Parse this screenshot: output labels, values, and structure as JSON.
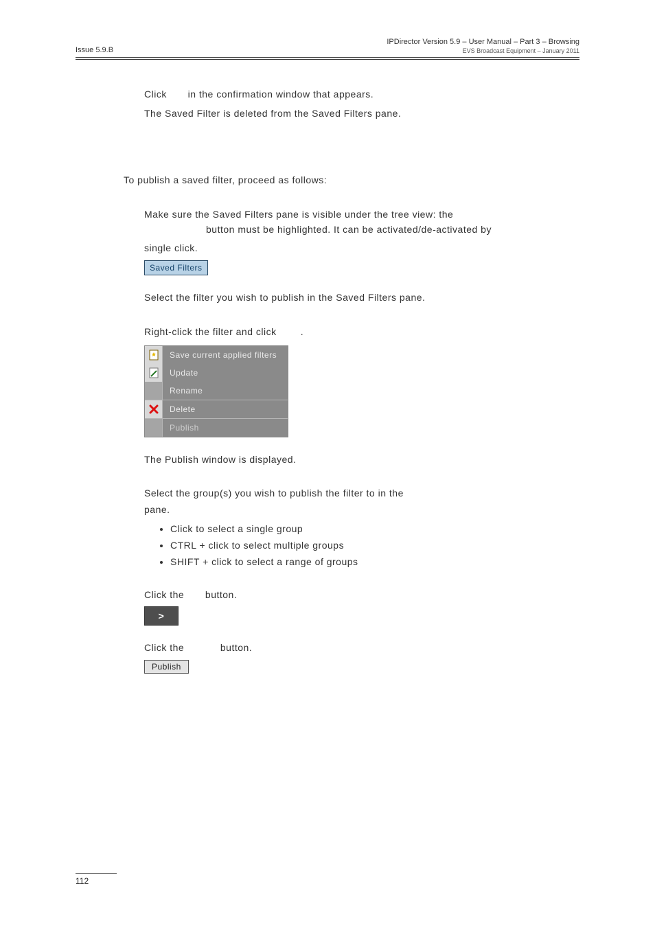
{
  "header": {
    "left": "Issue 5.9.B",
    "right_main": "IPDirector Version 5.9 – User Manual – Part 3 – Browsing",
    "right_sub": "EVS Broadcast Equipment – January 2011"
  },
  "intro": {
    "click_prefix": "Click ",
    "click_suffix": " in the confirmation window that appears.",
    "deleted": "The Saved Filter is deleted from the Saved Filters pane."
  },
  "publish_intro": "To publish a saved filter, proceed as follows:",
  "step1": {
    "line1": "Make sure the Saved Filters pane is visible under the tree view: the",
    "line2_pre": "",
    "line2_post": " button must be highlighted. It can be activated/de-activated by",
    "line3": "single click.",
    "btn": "Saved Filters"
  },
  "step2": "Select the filter you wish to publish in the Saved Filters pane.",
  "step3_pre": "Right-click the filter and click ",
  "step3_post": ".",
  "ctx": {
    "save": "Save current applied filters",
    "update": "Update",
    "rename": "Rename",
    "delete": "Delete",
    "publish": "Publish"
  },
  "step3_result": "The Publish window is displayed.",
  "step4_pre": "Select the group(s) you wish to publish the filter to in the ",
  "step4_post": "pane.",
  "bullets": {
    "b1": "Click to select a single group",
    "b2": "CTRL + click to select multiple groups",
    "b3": "SHIFT + click to select a range of groups"
  },
  "step5_pre": "Click the ",
  "step5_post": " button.",
  "arrow_label": ">",
  "step6_pre": "Click the ",
  "step6_post": " button.",
  "publish_btn": "Publish",
  "footer": {
    "page": "112"
  }
}
